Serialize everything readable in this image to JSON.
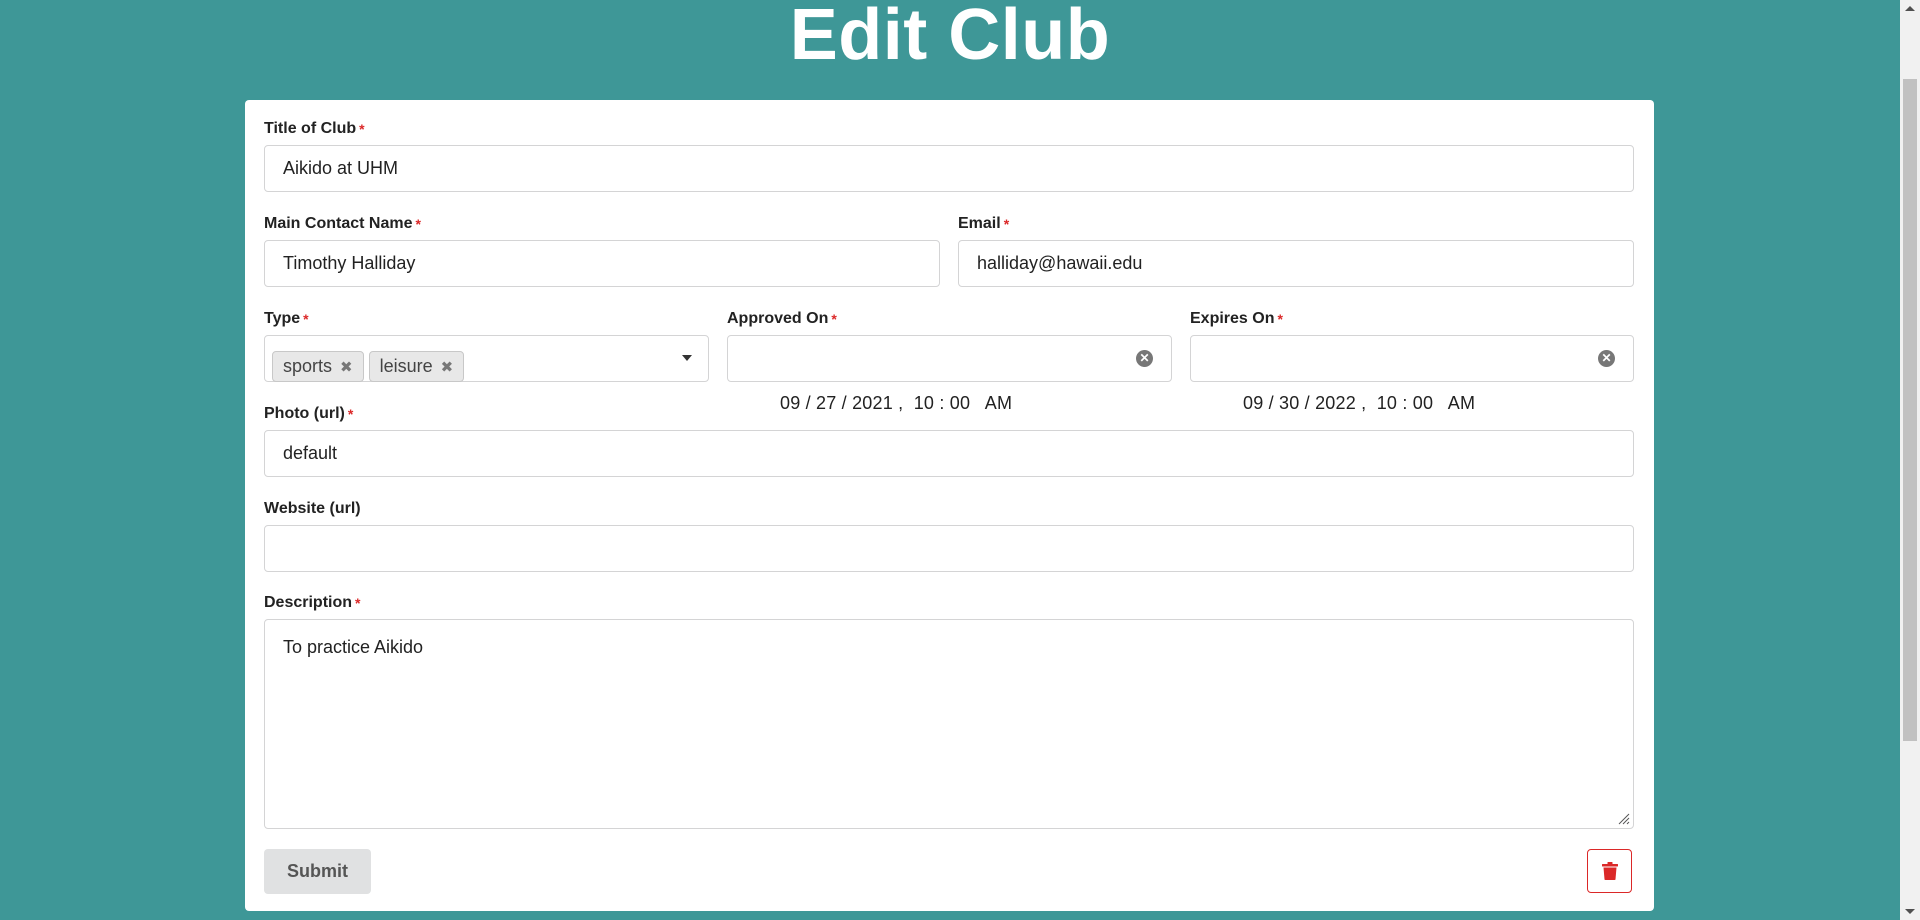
{
  "page": {
    "title": "Edit Club"
  },
  "form": {
    "title_of_club": {
      "label": "Title of Club",
      "required_mark": "*",
      "value": "Aikido at UHM"
    },
    "main_contact_name": {
      "label": "Main Contact Name",
      "required_mark": "*",
      "value": "Timothy Halliday"
    },
    "email": {
      "label": "Email",
      "required_mark": "*",
      "value": "halliday@hawaii.edu"
    },
    "type": {
      "label": "Type",
      "required_mark": "*",
      "selected": [
        {
          "label": "sports",
          "remove_icon": "x-icon"
        },
        {
          "label": "leisure",
          "remove_icon": "x-icon"
        }
      ]
    },
    "approved_on": {
      "label": "Approved On",
      "required_mark": "*",
      "value": "09 / 27 / 2021 ,  10 : 00   AM"
    },
    "expires_on": {
      "label": "Expires On",
      "required_mark": "*",
      "value": "09 / 30 / 2022 ,  10 : 00   AM"
    },
    "photo_url": {
      "label": "Photo (url)",
      "required_mark": "*",
      "value": "default"
    },
    "website_url": {
      "label": "Website (url)",
      "value": ""
    },
    "description": {
      "label": "Description",
      "required_mark": "*",
      "value": "To practice Aikido"
    },
    "submit_label": "Submit",
    "delete_icon": "trash-icon"
  },
  "colors": {
    "background": "#3e9797",
    "required": "#db2828",
    "delete_accent": "#db2828"
  }
}
